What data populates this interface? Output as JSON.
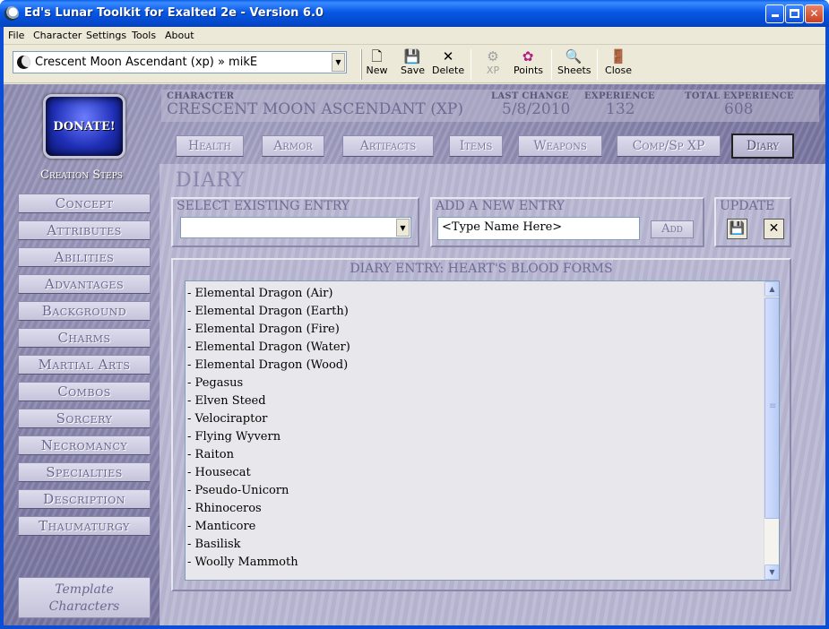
{
  "window": {
    "title": "Ed's Lunar Toolkit for Exalted 2e - Version 6.0"
  },
  "menu": [
    "File",
    "Character",
    "Settings",
    "Tools",
    "About"
  ],
  "toolbar": {
    "character_select_value": "Crescent Moon Ascendant (xp) » mikE",
    "buttons": [
      {
        "label": "New",
        "icon": "new-document-icon"
      },
      {
        "label": "Save",
        "icon": "floppy-disk-icon"
      },
      {
        "label": "Delete",
        "icon": "delete-x-icon"
      },
      {
        "label": "XP",
        "icon": "xp-icon",
        "disabled": true
      },
      {
        "label": "Points",
        "icon": "points-icon"
      },
      {
        "label": "Sheets",
        "icon": "sheets-icon"
      },
      {
        "label": "Close",
        "icon": "close-door-icon"
      }
    ]
  },
  "sidebar": {
    "donate_label": "DONATE!",
    "creation_steps_title": "Creation Steps",
    "steps": [
      "Concept",
      "Attributes",
      "Abilities",
      "Advantages",
      "Background",
      "Charms",
      "Martial Arts",
      "Combos",
      "Sorcery",
      "Necromancy",
      "Specialties",
      "Description",
      "Thaumaturgy"
    ],
    "template_button_line1": "Template",
    "template_button_line2": "Characters"
  },
  "header": {
    "character_label": "Character",
    "character_value": "Crescent Moon Ascendant (xp)",
    "last_change_label": "Last Change",
    "last_change_value": "5/8/2010",
    "experience_label": "Experience",
    "experience_value": "132",
    "total_experience_label": "Total Experience",
    "total_experience_value": "608"
  },
  "tabs": [
    {
      "label": "Health",
      "active": false
    },
    {
      "label": "Armor",
      "active": false
    },
    {
      "label": "Artifacts",
      "active": false
    },
    {
      "label": "Items",
      "active": false
    },
    {
      "label": "Weapons",
      "active": false
    },
    {
      "label": "Comp/Sp XP",
      "active": false
    },
    {
      "label": "Diary",
      "active": true
    }
  ],
  "diary": {
    "page_title": "Diary",
    "select_existing_label": "Select Existing Entry",
    "select_existing_value": "",
    "add_new_label": "Add a New Entry",
    "add_new_value": "<Type Name Here>",
    "add_button_label": "Add",
    "update_label": "Update",
    "entry_title": "Diary Entry: Heart's Blood Forms",
    "entry_lines": [
      "- Elemental Dragon (Air)",
      "- Elemental Dragon (Earth)",
      "- Elemental Dragon (Fire)",
      "- Elemental Dragon (Water)",
      "- Elemental Dragon (Wood)",
      "- Pegasus",
      "- Elven Steed",
      "- Velociraptor",
      "- Flying Wyvern",
      "- Raiton",
      "- Housecat",
      "- Pseudo-Unicorn",
      "- Rhinoceros",
      "- Manticore",
      "- Basilisk",
      "- Woolly Mammoth"
    ]
  }
}
